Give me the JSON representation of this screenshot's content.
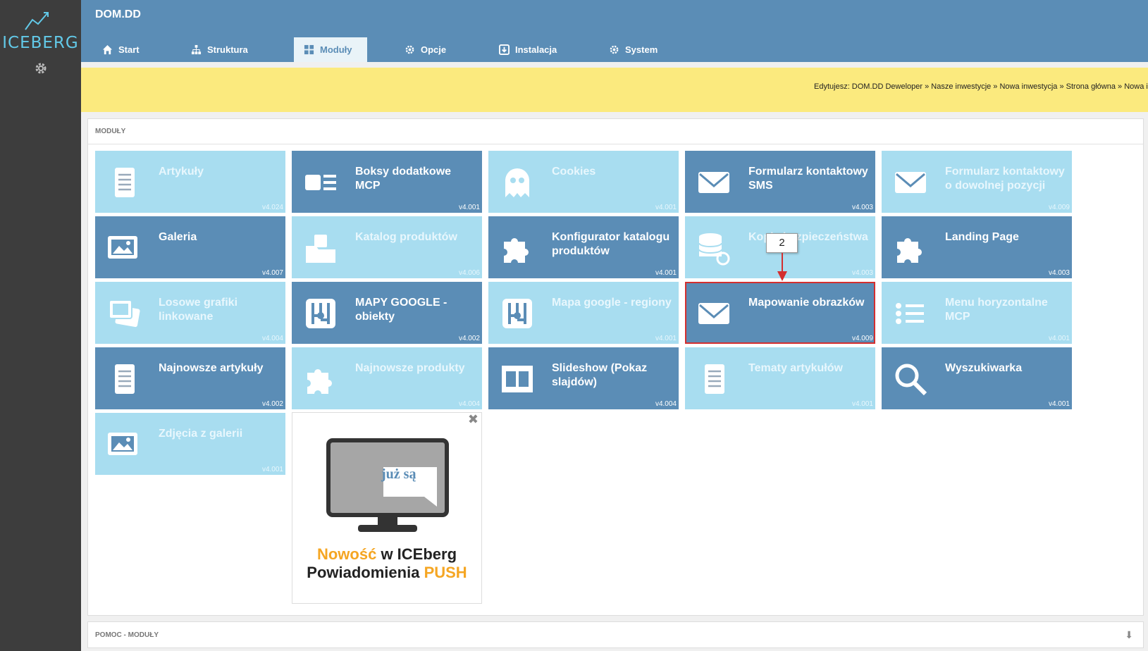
{
  "logo": {
    "text": "ICEBERG"
  },
  "header": {
    "site_name": "DOM.DD",
    "tabs": [
      {
        "label": "Start",
        "icon": "home-icon"
      },
      {
        "label": "Struktura",
        "icon": "sitemap-icon"
      },
      {
        "label": "Moduły",
        "icon": "modules-icon",
        "active": true
      },
      {
        "label": "Opcje",
        "icon": "gear-icon"
      },
      {
        "label": "Instalacja",
        "icon": "install-icon"
      },
      {
        "label": "System",
        "icon": "gear-icon"
      }
    ]
  },
  "breadcrumb": "Edytujesz: DOM.DD Deweloper » Nasze inwestycje » Nowa inwestycja » Strona główna » Nowa in",
  "modules_panel": {
    "title": "MODUŁY",
    "tiles": [
      {
        "name": "Artykuły",
        "version": "v4.024",
        "icon": "document-icon",
        "style": "light"
      },
      {
        "name": "Boksy dodatkowe MCP",
        "version": "v4.001",
        "icon": "boxes-icon",
        "style": "dark"
      },
      {
        "name": "Cookies",
        "version": "v4.001",
        "icon": "ghost-icon",
        "style": "light"
      },
      {
        "name": "Formularz kontaktowy SMS",
        "version": "v4.003",
        "icon": "envelope-icon",
        "style": "dark"
      },
      {
        "name": "Formularz kontaktowy o dowolnej pozycji",
        "version": "v4.009",
        "icon": "envelope-icon",
        "style": "light"
      },
      {
        "name": "Galeria",
        "version": "v4.007",
        "icon": "image-icon",
        "style": "dark"
      },
      {
        "name": "Katalog produktów",
        "version": "v4.006",
        "icon": "folder-icon",
        "style": "light"
      },
      {
        "name": "Konfigurator katalogu produktów",
        "version": "v4.001",
        "icon": "puzzle-icon",
        "style": "dark"
      },
      {
        "name": "Kopie bezpieczeństwa",
        "version": "v4.003",
        "icon": "database-icon",
        "style": "light"
      },
      {
        "name": "Landing Page",
        "version": "v4.003",
        "icon": "puzzle-icon",
        "style": "dark"
      },
      {
        "name": "Losowe grafiki linkowane",
        "version": "v4.004",
        "icon": "images-icon",
        "style": "light"
      },
      {
        "name": "MAPY GOOGLE - obiekty",
        "version": "v4.002",
        "icon": "map-icon",
        "style": "dark"
      },
      {
        "name": "Mapa google - regiony",
        "version": "v4.001",
        "icon": "map-icon",
        "style": "light"
      },
      {
        "name": "Mapowanie obrazków",
        "version": "v4.009",
        "icon": "envelope-icon",
        "style": "dark",
        "selected": true
      },
      {
        "name": "Menu horyzontalne MCP",
        "version": "v4.001",
        "icon": "list-icon",
        "style": "light"
      },
      {
        "name": "Najnowsze artykuły",
        "version": "v4.002",
        "icon": "document-icon",
        "style": "dark"
      },
      {
        "name": "Najnowsze produkty",
        "version": "v4.004",
        "icon": "puzzle-icon",
        "style": "light"
      },
      {
        "name": "Slideshow (Pokaz slajdów)",
        "version": "v4.004",
        "icon": "film-icon",
        "style": "dark"
      },
      {
        "name": "Tematy artykułów",
        "version": "v4.001",
        "icon": "document-icon",
        "style": "light"
      },
      {
        "name": "Wyszukiwarka",
        "version": "v4.001",
        "icon": "search-icon",
        "style": "dark"
      },
      {
        "name": "Zdjęcia z galerii",
        "version": "v4.001",
        "icon": "image-icon",
        "style": "light"
      }
    ]
  },
  "promo": {
    "speech": "już są",
    "line1_a": "Nowość",
    "line1_b": " w ICEberg",
    "line2_a": "Powiadomienia ",
    "line2_b": "PUSH",
    "close": "✖"
  },
  "callout": {
    "number": "2"
  },
  "help_panel": {
    "title": "POMOC - MODUŁY",
    "toggle": "⬇"
  },
  "colors": {
    "header": "#5b8db6",
    "tile_dark": "#5b8db6",
    "tile_light": "#a8ddf0",
    "info": "#fbea7e",
    "accent": "#f5a623",
    "highlight": "#d32f2f"
  }
}
